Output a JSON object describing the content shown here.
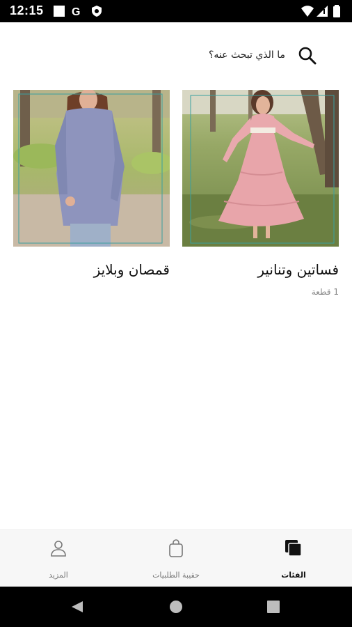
{
  "status_bar": {
    "time": "12:15",
    "icons": [
      "square-notification-icon",
      "google-icon",
      "shield-icon",
      "wifi-icon",
      "signal-icon",
      "battery-icon"
    ]
  },
  "search": {
    "placeholder": "ما الذي تبحث عنه؟"
  },
  "categories": [
    {
      "title": "فساتين وتنانير",
      "count": "1 قطعة",
      "image": "woman-in-pink-dress-photo"
    },
    {
      "title": "قمصان وبلايز",
      "count": "",
      "image": "woman-in-blue-blouse-photo"
    }
  ],
  "bottom_nav": {
    "items": [
      {
        "label": "الفئات",
        "icon": "categories-icon",
        "active": true
      },
      {
        "label": "حقيبة الطلبيات",
        "icon": "shopping-bag-icon",
        "active": false
      },
      {
        "label": "المزيد",
        "icon": "person-icon",
        "active": false
      }
    ]
  },
  "colors": {
    "status_bar": "#000000",
    "nav_background": "#f7f7f7",
    "dress_pink": "#e8a5aa",
    "blouse_blue": "#8e94bd"
  }
}
